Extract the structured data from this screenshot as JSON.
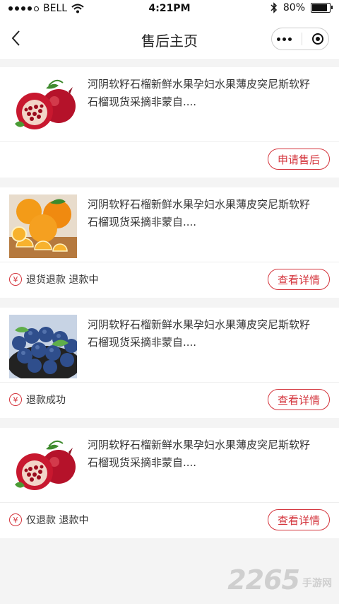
{
  "status_bar": {
    "carrier": "BELL",
    "time": "4:21PM",
    "battery": "80%"
  },
  "nav": {
    "title": "售后主页"
  },
  "orders": [
    {
      "image": "pomegranate",
      "description": "河阴软籽石榴新鲜水果孕妇水果薄皮突尼斯软籽石榴现货采摘非蒙自....",
      "status": "",
      "button": "申请售后"
    },
    {
      "image": "orange",
      "description": "河阴软籽石榴新鲜水果孕妇水果薄皮突尼斯软籽石榴现货采摘非蒙自....",
      "status": "退货退款 退款中",
      "button": "查看详情"
    },
    {
      "image": "blueberry",
      "description": "河阴软籽石榴新鲜水果孕妇水果薄皮突尼斯软籽石榴现货采摘非蒙自....",
      "status": "退款成功",
      "button": "查看详情"
    },
    {
      "image": "pomegranate",
      "description": "河阴软籽石榴新鲜水果孕妇水果薄皮突尼斯软籽石榴现货采摘非蒙自....",
      "status": "仅退款 退款中",
      "button": "查看详情"
    }
  ],
  "yen_symbol": "¥",
  "watermark": {
    "number": "2265",
    "suffix": "手游网"
  },
  "colors": {
    "accent": "#d4343c"
  }
}
